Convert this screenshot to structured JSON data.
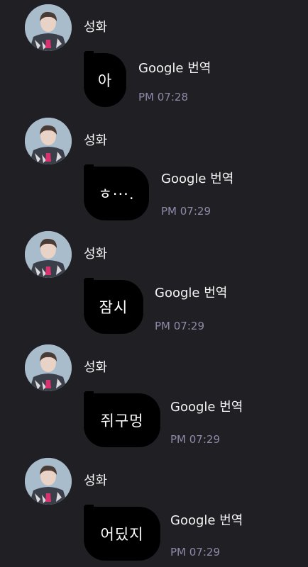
{
  "messages": [
    {
      "sender": "성화",
      "text": "아",
      "app_label": "Google 번역",
      "time": "PM 07:28"
    },
    {
      "sender": "성화",
      "text": "ㅎ···.",
      "app_label": "Google 번역",
      "time": "PM 07:29"
    },
    {
      "sender": "성화",
      "text": "잠시",
      "app_label": "Google 번역",
      "time": "PM 07:29"
    },
    {
      "sender": "성화",
      "text": "쥐구멍",
      "app_label": "Google 번역",
      "time": "PM 07:29"
    },
    {
      "sender": "성화",
      "text": "어딨지",
      "app_label": "Google 번역",
      "time": "PM 07:29"
    }
  ],
  "colors": {
    "background": "#202024",
    "bubble": "#000000",
    "time": "#8d8aa8"
  }
}
